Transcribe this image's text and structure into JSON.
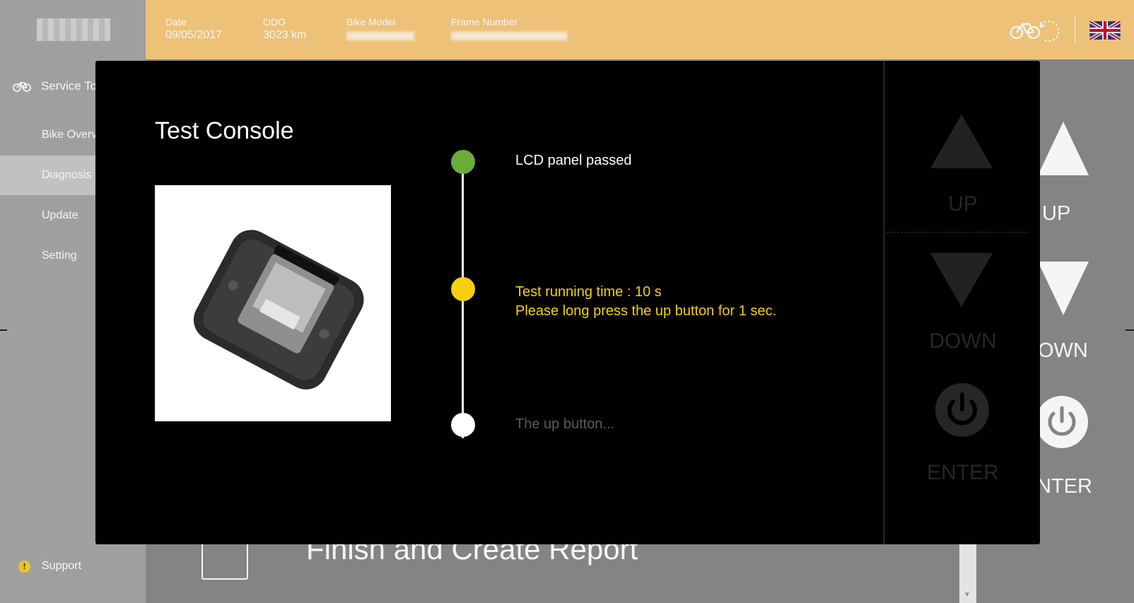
{
  "sidebar": {
    "section_title": "Service To",
    "items": [
      {
        "label": "Bike Overv"
      },
      {
        "label": "Diagnosis"
      },
      {
        "label": "Update"
      },
      {
        "label": "Setting"
      }
    ],
    "support_label": "Support"
  },
  "header": {
    "date_label": "Date",
    "date_value": "09/05/2017",
    "odo_label": "ODO",
    "odo_value": "3023 km",
    "model_label": "Bike Model",
    "frame_label": "Frame Number"
  },
  "main": {
    "finish_label": "Finish and Create Report",
    "pad": {
      "up": "UP",
      "down": "OWN",
      "enter": "NTER"
    }
  },
  "modal": {
    "title": "Test Console",
    "steps": [
      {
        "line1": "LCD panel passed",
        "color": "#6bab3c"
      },
      {
        "line1": "Test running time : 10 s",
        "line2": "Please long press the up button for 1 sec.",
        "color": "#f5d00f"
      },
      {
        "line1": "The up button...",
        "color": "#ffffff"
      }
    ],
    "pad": {
      "up": "UP",
      "down": "DOWN",
      "enter": "ENTER"
    }
  },
  "colors": {
    "accent": "#f7c97d",
    "done": "#6bab3c",
    "running": "#f5d00f",
    "pending_text": "#5c5c5c"
  }
}
